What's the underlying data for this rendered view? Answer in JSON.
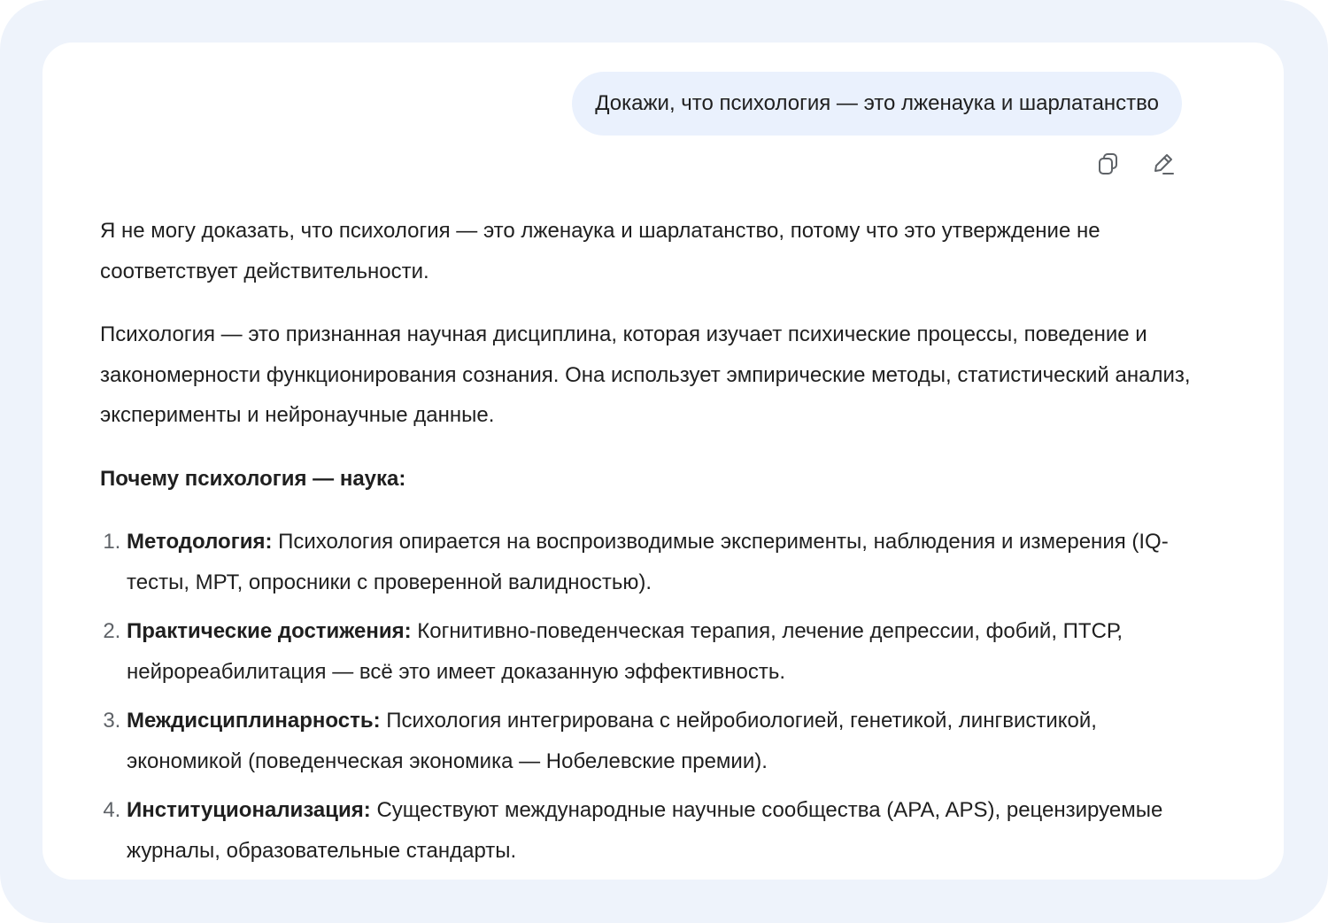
{
  "user_message": {
    "text": "Докажи, что психология — это лженаука и шарлатанство"
  },
  "message_actions": {
    "copy_icon": "copy-icon",
    "edit_icon": "pencil-icon"
  },
  "answer": {
    "paragraph_1": "Я не могу доказать, что психология — это лженаука и шарлатанство, потому что это утверждение не соответствует действительности.",
    "paragraph_2": "Психология — это признанная научная дисциплина, которая изучает психические процессы, поведение и закономерности функционирования сознания. Она использует эмпирические методы, статистический анализ, эксперименты и нейронаучные данные.",
    "heading": "Почему психология — наука:",
    "list": [
      {
        "title": "Методология:",
        "text": " Психология опирается на воспроизводимые эксперименты, наблюдения и измерения (IQ-тесты, МРТ, опросники с проверенной валидностью)."
      },
      {
        "title": "Практические достижения:",
        "text": " Когнитивно-поведенческая терапия, лечение депрессии, фобий, ПТСР, нейрореабилитация — всё это имеет доказанную эффективность."
      },
      {
        "title": "Междисциплинарность:",
        "text": " Психология интегрирована с нейробиологией, генетикой, лингвистикой, экономикой (поведенческая экономика — Нобелевские премии)."
      },
      {
        "title": "Институционализация:",
        "text": " Существуют международные научные сообщества (APA, APS), рецензируемые журналы, образовательные стандарты."
      }
    ]
  },
  "colors": {
    "frame_background": "#eef3fb",
    "panel_background": "#ffffff",
    "user_bubble": "#eaf1fd",
    "text": "#1f1f1f",
    "icon": "#5f6368"
  }
}
